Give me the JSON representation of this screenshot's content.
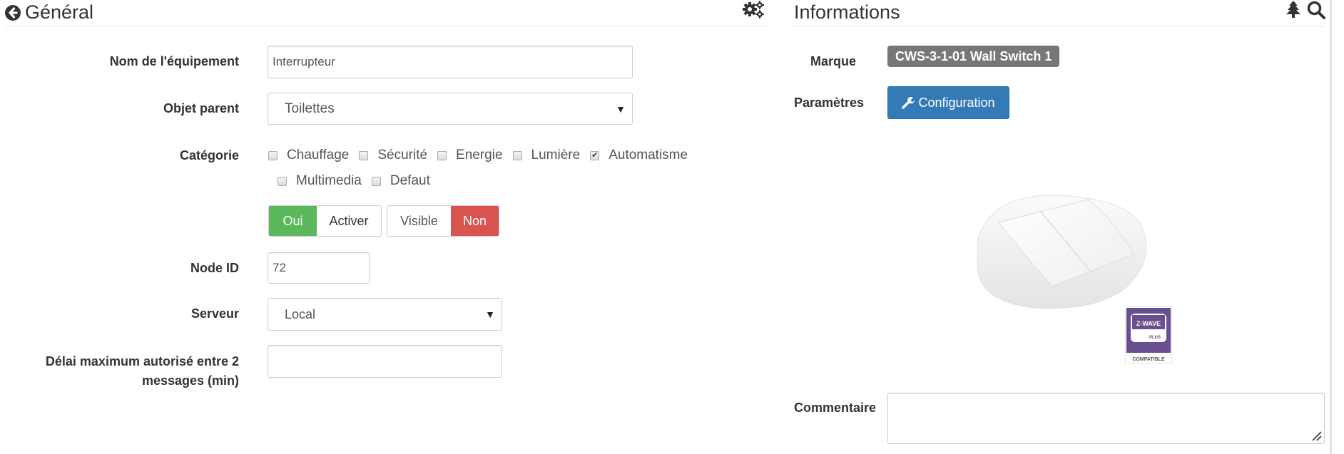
{
  "general": {
    "title": "Général",
    "back_icon": "arrow-circle-left-icon",
    "settings_icon": "gears-icon",
    "fields": {
      "name_label": "Nom de l'équipement",
      "name_value": "Interrupteur",
      "parent_label": "Objet parent",
      "parent_value": "Toilettes",
      "category_label": "Catégorie",
      "categories": [
        {
          "label": "Chauffage",
          "checked": false
        },
        {
          "label": "Sécurité",
          "checked": false
        },
        {
          "label": "Energie",
          "checked": false
        },
        {
          "label": "Lumière",
          "checked": false
        },
        {
          "label": "Automatisme",
          "checked": true
        },
        {
          "label": "Multimedia",
          "checked": false
        },
        {
          "label": "Defaut",
          "checked": false
        }
      ],
      "enable_toggle": {
        "on_label": "Oui",
        "label": "Activer",
        "state": "on"
      },
      "visible_toggle": {
        "label": "Visible",
        "off_label": "Non",
        "state": "off"
      },
      "node_id_label": "Node ID",
      "node_id_value": "72",
      "server_label": "Serveur",
      "server_value": "Local",
      "delay_label_line1": "Délai maximum autorisé entre 2",
      "delay_label_line2": "messages (min)",
      "delay_value": ""
    }
  },
  "informations": {
    "title": "Informations",
    "tree_icon": "tree-icon",
    "search_icon": "search-icon",
    "brand_label": "Marque",
    "brand_value": "CWS-3-1-01 Wall Switch 1",
    "params_label": "Paramètres",
    "config_button": "Configuration",
    "config_icon": "wrench-icon",
    "device_image": "wall-switch-image",
    "badge": {
      "brand": "Z-WAVE",
      "sub": "PLUS",
      "footer": "COMPATIBLE"
    },
    "comment_label": "Commentaire",
    "comment_value": ""
  },
  "colors": {
    "success": "#5cb85c",
    "danger": "#d9534f",
    "primary": "#337ab7",
    "badge": "#777777",
    "zwave_purple": "#6a4f8f"
  }
}
